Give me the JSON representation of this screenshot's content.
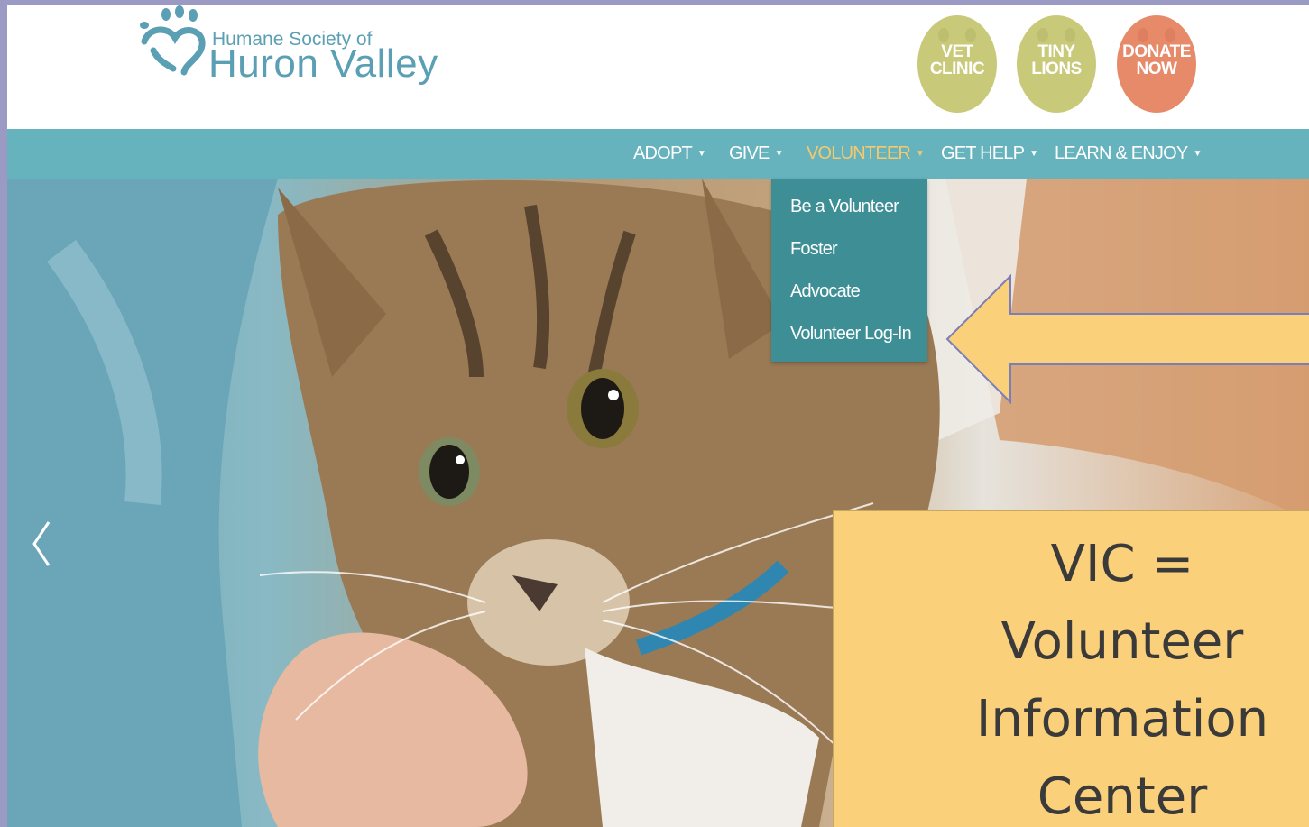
{
  "header": {
    "logo_small": "Humane Society of",
    "logo_big": "Huron Valley",
    "logo_icon": "paw-heart-icon",
    "badges": [
      {
        "label": "VET CLINIC",
        "line1": "VET",
        "line2": "CLINIC",
        "color": "#c9c97a"
      },
      {
        "label": "TINY LIONS",
        "line1": "TINY",
        "line2": "LIONS",
        "color": "#c9c97a"
      },
      {
        "label": "DONATE NOW",
        "line1": "DONATE",
        "line2": "NOW",
        "color": "#e78a69"
      }
    ]
  },
  "nav": {
    "items": [
      {
        "label": "ADOPT"
      },
      {
        "label": "GIVE"
      },
      {
        "label": "VOLUNTEER",
        "active": true
      },
      {
        "label": "GET HELP"
      },
      {
        "label": "LEARN & ENJOY"
      }
    ],
    "caret_icon": "caret-down-icon",
    "background": "#66b3bd",
    "active_color": "#f6c96d"
  },
  "dropdown": {
    "items": [
      {
        "label": "Be a Volunteer"
      },
      {
        "label": "Foster"
      },
      {
        "label": "Advocate"
      },
      {
        "label": "Volunteer Log-In"
      }
    ],
    "background": "#3d8f95"
  },
  "hero": {
    "prev_icon": "chevron-left-icon",
    "image": "kitten-photo"
  },
  "annotation": {
    "arrow_icon": "left-arrow-icon",
    "lines": [
      "VIC =",
      "Volunteer",
      "Information",
      "Center"
    ],
    "color": "#fbd07a"
  }
}
